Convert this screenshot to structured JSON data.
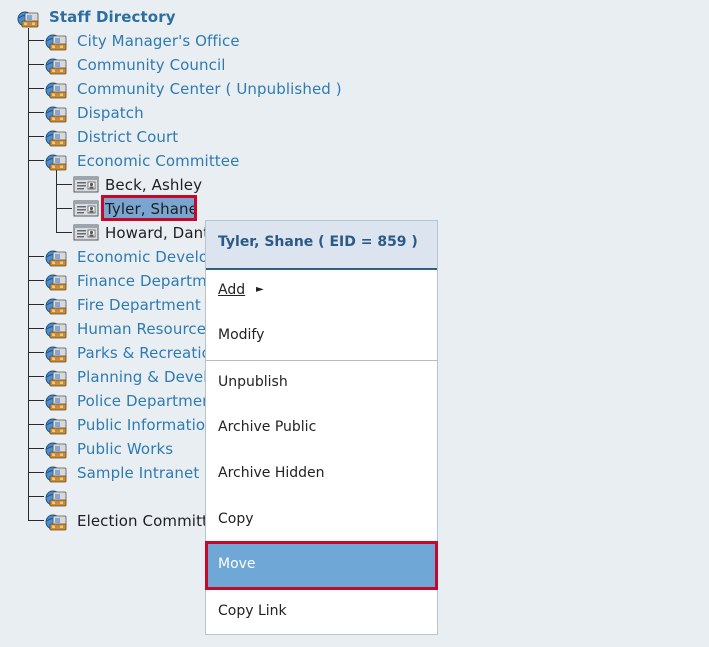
{
  "tree": {
    "root_label": "Staff Directory",
    "departments": [
      "City Manager's Office",
      "Community Council",
      "Community Center ( Unpublished )",
      "Dispatch",
      "District Court",
      "Economic Committee",
      "Economic Develop",
      "Finance Departm",
      "Fire Department",
      "Human Resource",
      "Parks & Recreatio",
      "Planning & Develo",
      "Police Departmen",
      "Public Informatio",
      "Public Works",
      "Sample Intranet",
      "",
      "Election Committe"
    ],
    "employees": [
      "Beck, Ashley",
      "Tyler, Shane",
      "Howard, Dant"
    ],
    "selected_employee": "Tyler, Shane"
  },
  "context_menu": {
    "header": "Tyler, Shane ( EID = 859 )",
    "items": {
      "add": "Add",
      "add_arrow": "►",
      "modify": "Modify",
      "unpublish": "Unpublish",
      "archive_public": "Archive Public",
      "archive_hidden": "Archive Hidden",
      "copy": "Copy",
      "move": "Move",
      "copy_link": "Copy Link"
    },
    "highlighted_item": "Move"
  },
  "icons": {
    "department": "department-folder-icon",
    "employee": "employee-card-icon"
  },
  "colors": {
    "link_blue": "#2f7bb0",
    "selection_red": "#c40a2b",
    "menu_header_bg": "#dce5ef",
    "menu_highlight_bg": "#6fa8d6"
  }
}
